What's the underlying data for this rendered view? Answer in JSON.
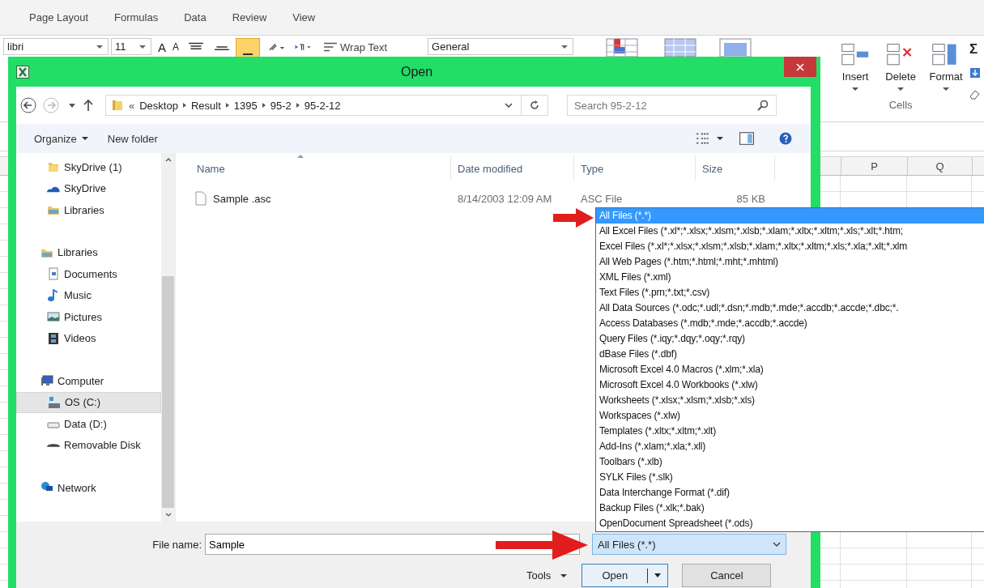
{
  "excel": {
    "tabs": [
      {
        "label": "Page Layout",
        "selected": false
      },
      {
        "label": "Formulas",
        "selected": false
      },
      {
        "label": "Data",
        "selected": false
      },
      {
        "label": "Review",
        "selected": false
      },
      {
        "label": "View",
        "selected": false
      }
    ],
    "ribbon": {
      "font_name": "libri",
      "font_size": "11",
      "grow_font": "A",
      "shrink_font": "A",
      "wrap_text": "Wrap Text",
      "number_format": "General",
      "cells_buttons": [
        "Insert",
        "Delete",
        "Format"
      ],
      "cells_group": "Cells",
      "sum_symbol": "Σ"
    },
    "columns": [
      "P",
      "Q"
    ]
  },
  "dialog": {
    "title": "Open",
    "address": {
      "overflow": "«",
      "crumbs": [
        "Desktop",
        "Result",
        "1395",
        "95-2",
        "95-2-12"
      ]
    },
    "search": {
      "placeholder": "Search 95-2-12"
    },
    "toolbar": {
      "organize": "Organize",
      "new_folder": "New folder"
    },
    "nav_pane": {
      "groups": [
        {
          "children": [
            {
              "label": "SkyDrive (1)",
              "kind": "folder",
              "selected": false
            },
            {
              "label": "SkyDrive",
              "kind": "cloud",
              "selected": false
            },
            {
              "label": "Libraries",
              "kind": "library",
              "selected": false
            }
          ]
        },
        {
          "label": "Libraries",
          "kind": "library",
          "selected": false,
          "children": [
            {
              "label": "Documents",
              "kind": "documents",
              "selected": false
            },
            {
              "label": "Music",
              "kind": "music",
              "selected": false
            },
            {
              "label": "Pictures",
              "kind": "pictures",
              "selected": false
            },
            {
              "label": "Videos",
              "kind": "videos",
              "selected": false
            }
          ]
        },
        {
          "label": "Computer",
          "kind": "computer",
          "selected": false,
          "children": [
            {
              "label": "OS (C:)",
              "kind": "system-drive",
              "selected": true
            },
            {
              "label": "Data (D:)",
              "kind": "drive",
              "selected": false
            },
            {
              "label": "Removable Disk",
              "kind": "removable",
              "selected": false
            }
          ]
        },
        {
          "label": "Network",
          "kind": "network",
          "selected": false
        }
      ]
    },
    "file_list": {
      "columns": [
        "Name",
        "Date modified",
        "Type",
        "Size"
      ],
      "rows": [
        {
          "name": "Sample .asc",
          "date_modified": "8/14/2003 12:09 AM",
          "type": "ASC File",
          "size": "85 KB",
          "selected": false
        }
      ]
    },
    "file_name": {
      "label": "File name:",
      "value": "Sample"
    },
    "file_type": {
      "value": "All Files (*.*)",
      "expanded": true,
      "options": [
        {
          "label": "All Files (*.*)",
          "selected": true
        },
        {
          "label": "All Excel Files (*.xl*;*.xlsx;*.xlsm;*.xlsb;*.xlam;*.xltx;*.xltm;*.xls;*.xlt;*.htm;",
          "selected": false
        },
        {
          "label": "Excel Files (*.xl*;*.xlsx;*.xlsm;*.xlsb;*.xlam;*.xltx;*.xltm;*.xls;*.xla;*.xlt;*.xlm",
          "selected": false
        },
        {
          "label": "All Web Pages (*.htm;*.html;*.mht;*.mhtml)",
          "selected": false
        },
        {
          "label": "XML Files (*.xml)",
          "selected": false
        },
        {
          "label": "Text Files (*.prn;*.txt;*.csv)",
          "selected": false
        },
        {
          "label": "All Data Sources (*.odc;*.udl;*.dsn;*.mdb;*.mde;*.accdb;*.accde;*.dbc;*.",
          "selected": false
        },
        {
          "label": "Access Databases (*.mdb;*.mde;*.accdb;*.accde)",
          "selected": false
        },
        {
          "label": "Query Files (*.iqy;*.dqy;*.oqy;*.rqy)",
          "selected": false
        },
        {
          "label": "dBase Files (*.dbf)",
          "selected": false
        },
        {
          "label": "Microsoft Excel 4.0 Macros (*.xlm;*.xla)",
          "selected": false
        },
        {
          "label": "Microsoft Excel 4.0 Workbooks (*.xlw)",
          "selected": false
        },
        {
          "label": "Worksheets (*.xlsx;*.xlsm;*.xlsb;*.xls)",
          "selected": false
        },
        {
          "label": "Workspaces (*.xlw)",
          "selected": false
        },
        {
          "label": "Templates (*.xltx;*.xltm;*.xlt)",
          "selected": false
        },
        {
          "label": "Add-Ins (*.xlam;*.xla;*.xll)",
          "selected": false
        },
        {
          "label": "Toolbars (*.xlb)",
          "selected": false
        },
        {
          "label": "SYLK Files (*.slk)",
          "selected": false
        },
        {
          "label": "Data Interchange Format (*.dif)",
          "selected": false
        },
        {
          "label": "Backup Files (*.xlk;*.bak)",
          "selected": false
        },
        {
          "label": "OpenDocument Spreadsheet (*.ods)",
          "selected": false
        }
      ]
    },
    "tools": "Tools",
    "open": "Open",
    "cancel": "Cancel"
  }
}
